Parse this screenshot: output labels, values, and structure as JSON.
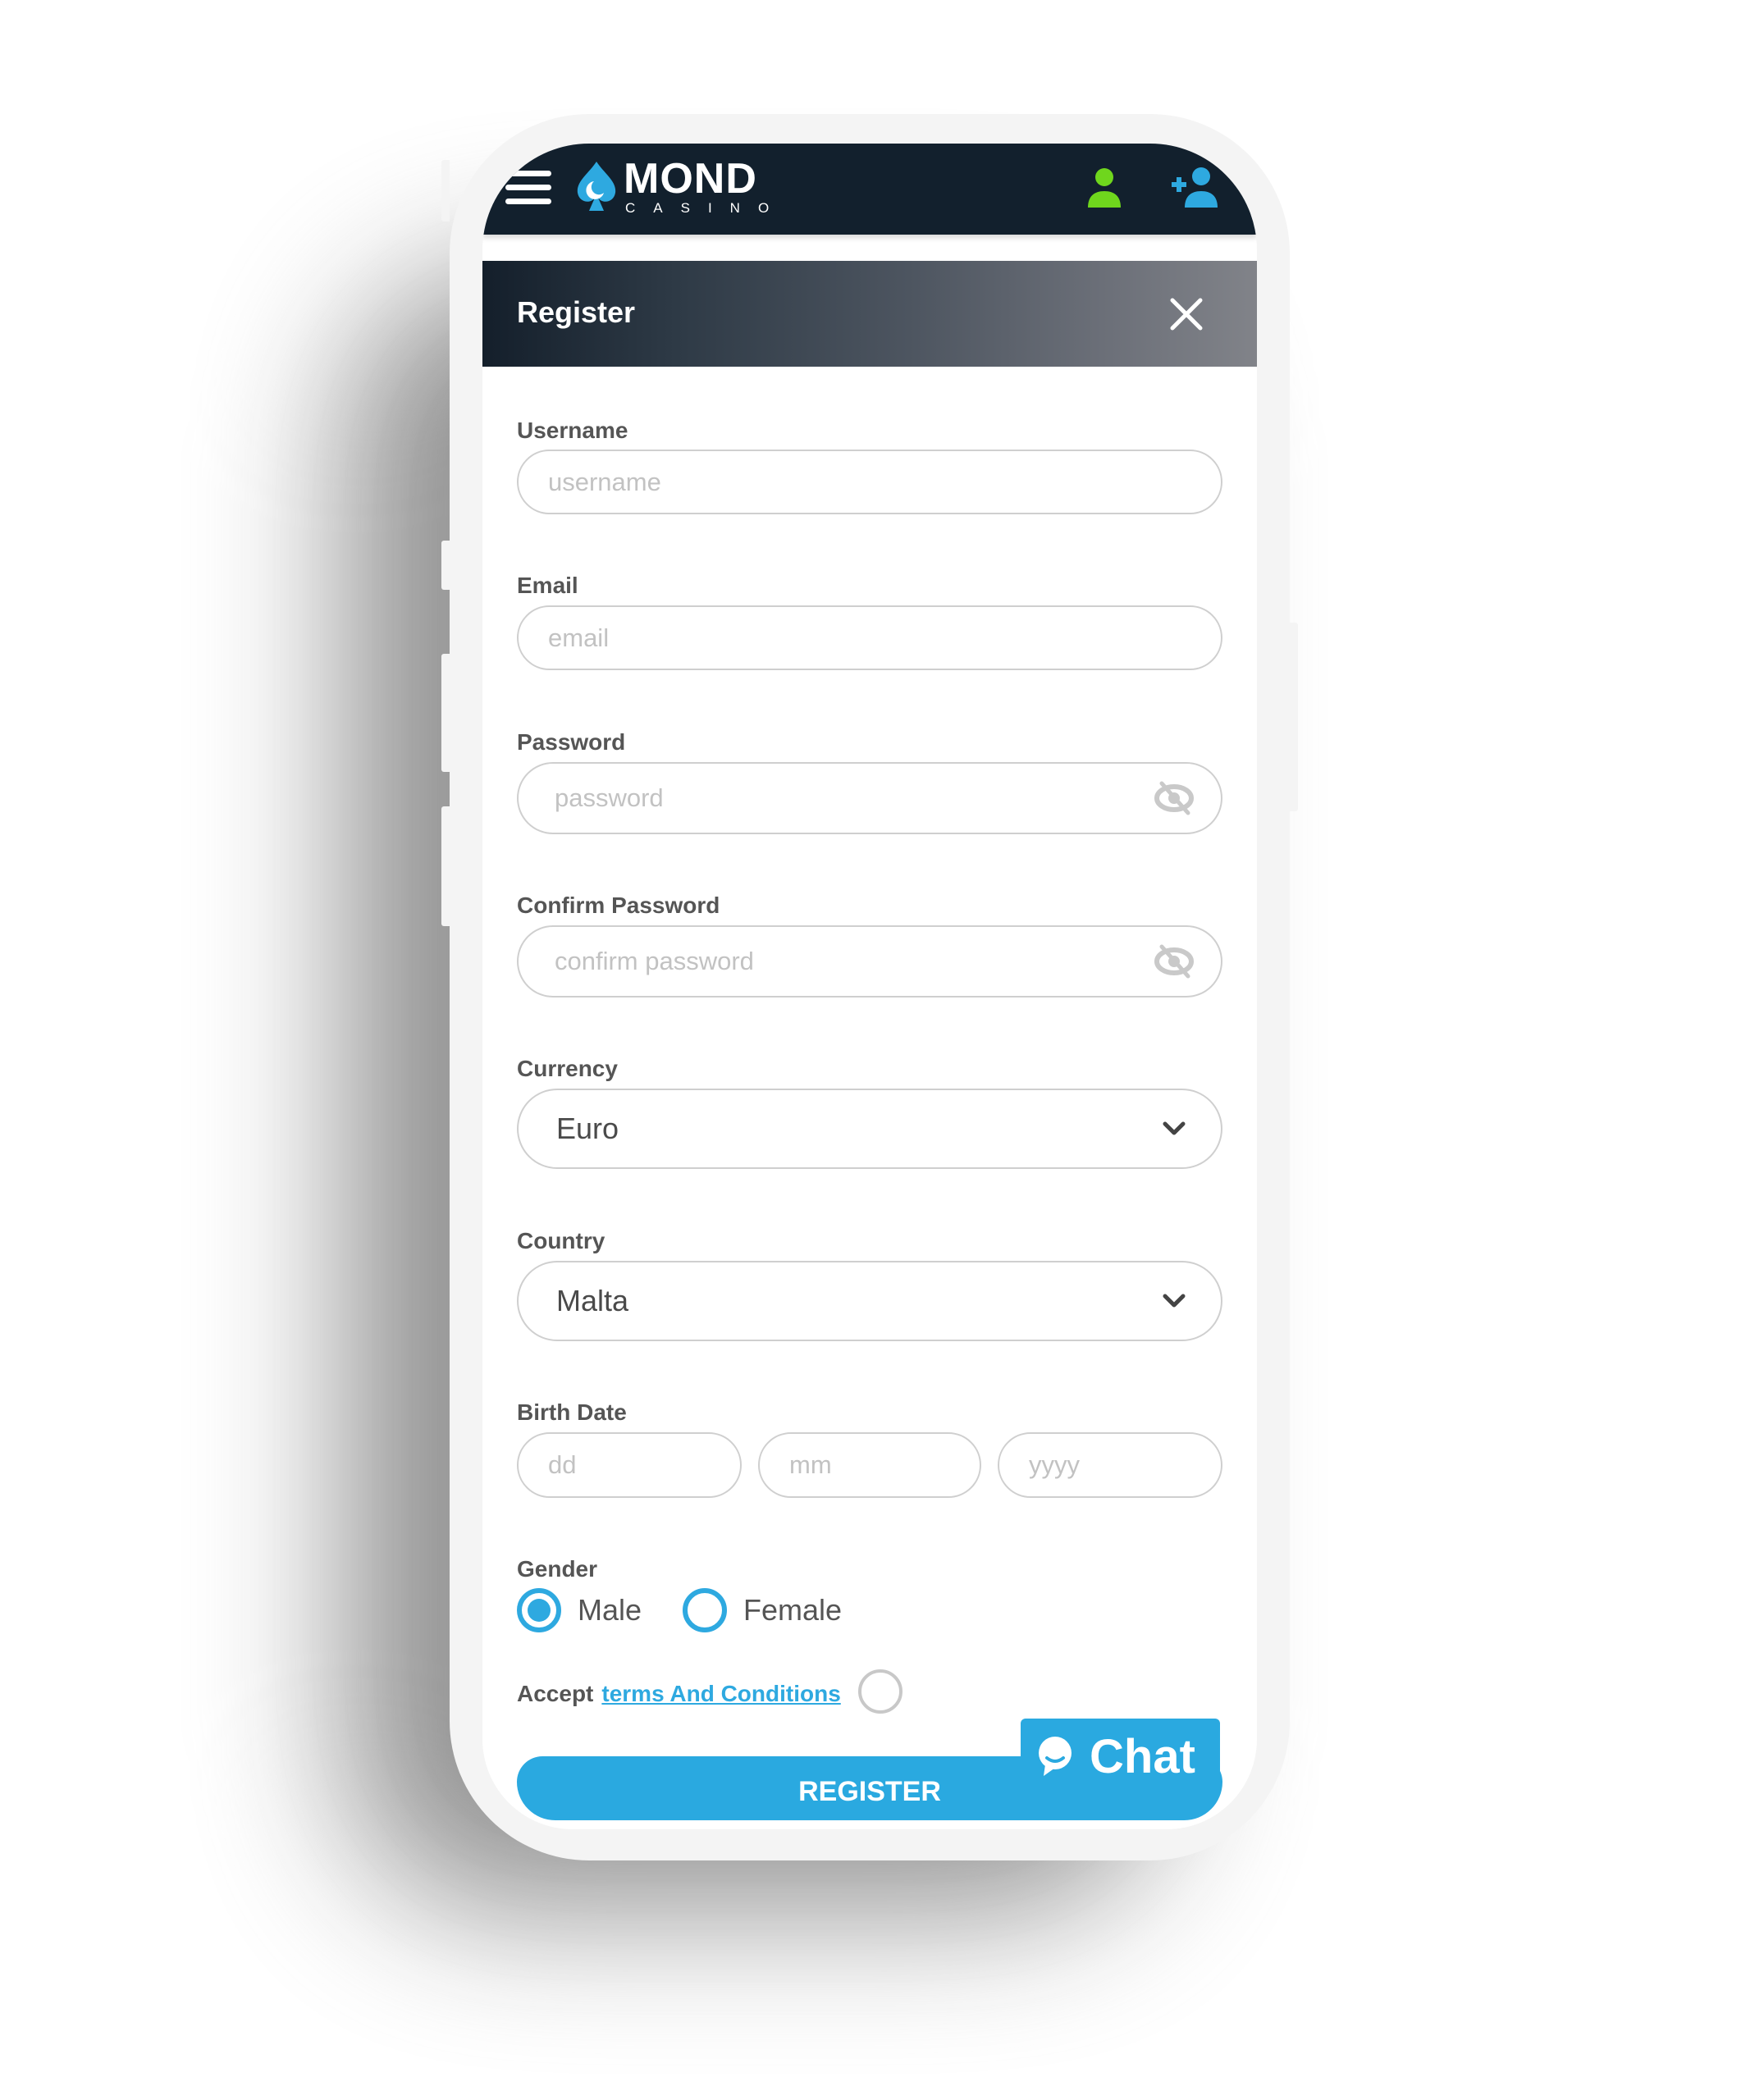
{
  "brand": {
    "name": "MOND",
    "sub": "CASINO",
    "colors": {
      "accent": "#2aa9e0",
      "login_icon": "#6fd61d",
      "header_bg": "#12202d"
    }
  },
  "header": {
    "menu_icon": "hamburger-icon",
    "login_icon": "user-icon",
    "signup_icon": "user-plus-icon"
  },
  "modal": {
    "title": "Register",
    "close_icon": "close-icon",
    "fields": {
      "username": {
        "label": "Username",
        "placeholder": "username",
        "value": ""
      },
      "email": {
        "label": "Email",
        "placeholder": "email",
        "value": ""
      },
      "password": {
        "label": "Password",
        "placeholder": "password",
        "value": "",
        "icon": "eye-slash-icon"
      },
      "confirm_password": {
        "label": "Confirm Password",
        "placeholder": "confirm password",
        "value": "",
        "icon": "eye-slash-icon"
      },
      "currency": {
        "label": "Currency",
        "value": "Euro"
      },
      "country": {
        "label": "Country",
        "value": "Malta"
      },
      "birth_date": {
        "label": "Birth Date",
        "dd_placeholder": "dd",
        "mm_placeholder": "mm",
        "yyyy_placeholder": "yyyy"
      },
      "gender": {
        "label": "Gender",
        "options": [
          "Male",
          "Female"
        ],
        "selected": "Male"
      }
    },
    "accept_prefix": "Accept",
    "terms_link": "terms And Conditions",
    "terms_checked": false,
    "register_label": "REGISTER"
  },
  "chat": {
    "label": "Chat",
    "icon": "chat-bubble-icon"
  }
}
